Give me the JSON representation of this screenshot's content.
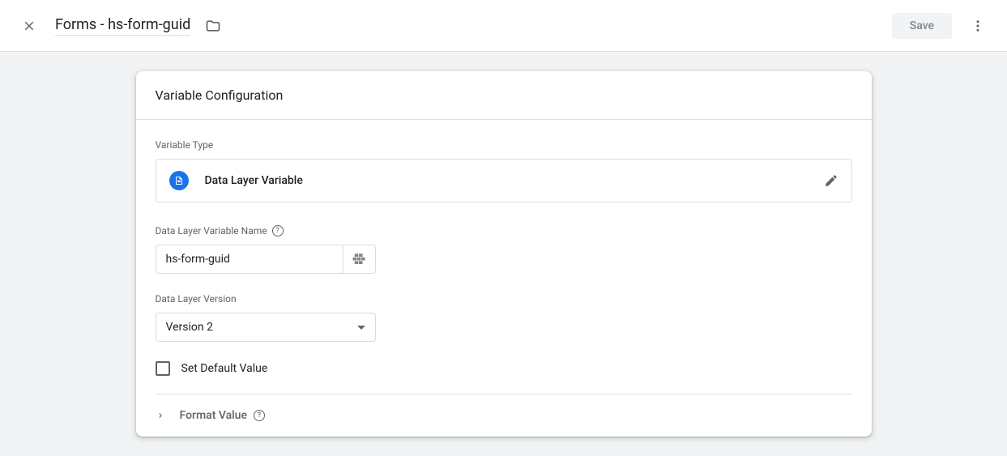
{
  "header": {
    "title": "Forms - hs-form-guid",
    "save_label": "Save"
  },
  "card": {
    "title": "Variable Configuration",
    "variable_type_label": "Variable Type",
    "variable_type_name": "Data Layer Variable",
    "var_name_label": "Data Layer Variable Name",
    "var_name_value": "hs-form-guid",
    "version_label": "Data Layer Version",
    "version_value": "Version 2",
    "default_checkbox_label": "Set Default Value",
    "format_value_label": "Format Value"
  }
}
